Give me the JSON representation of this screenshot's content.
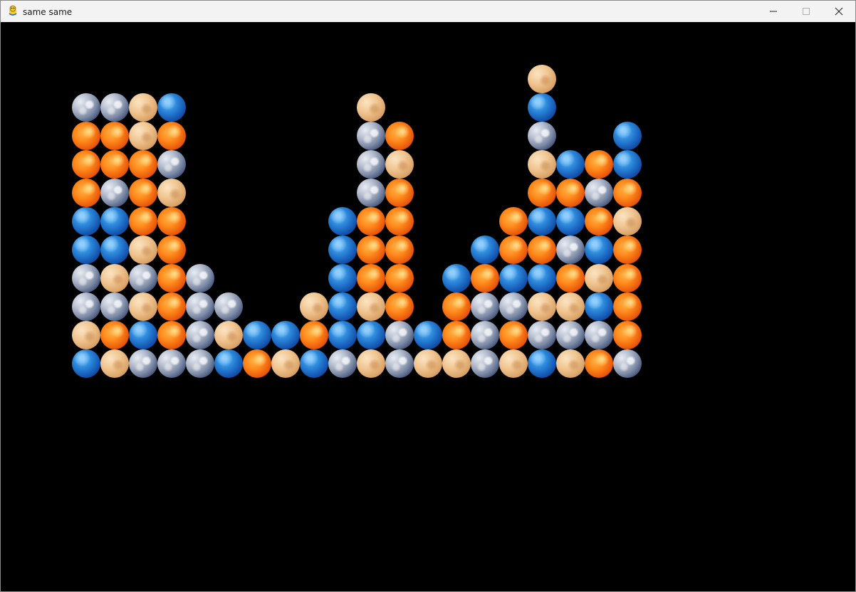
{
  "window": {
    "title": "same same",
    "minimize_icon": "minimize-icon",
    "maximize_icon": "maximize-icon",
    "close_icon": "close-icon",
    "app_icon": "pygame-snake-icon"
  },
  "game": {
    "background": "#000000",
    "colors": {
      "E": "earth",
      "B": "blue",
      "S": "sun",
      "T": "sand"
    },
    "columns": [
      [
        "B",
        "T",
        "E",
        "E",
        "B",
        "B",
        "S",
        "S",
        "S",
        "E"
      ],
      [
        "T",
        "S",
        "E",
        "T",
        "B",
        "B",
        "E",
        "S",
        "S",
        "E"
      ],
      [
        "E",
        "B",
        "T",
        "E",
        "T",
        "S",
        "S",
        "S",
        "T",
        "T"
      ],
      [
        "E",
        "S",
        "S",
        "S",
        "S",
        "S",
        "T",
        "E",
        "S",
        "B"
      ],
      [
        "E",
        "E",
        "E",
        "E"
      ],
      [
        "B",
        "T",
        "E"
      ],
      [
        "S",
        "B"
      ],
      [
        "T",
        "B"
      ],
      [
        "B",
        "S",
        "T"
      ],
      [
        "E",
        "B",
        "B",
        "B",
        "B",
        "B"
      ],
      [
        "T",
        "B",
        "T",
        "S",
        "S",
        "S",
        "E",
        "E",
        "E",
        "T"
      ],
      [
        "E",
        "E",
        "S",
        "S",
        "S",
        "S",
        "S",
        "T",
        "S"
      ],
      [
        "T",
        "B"
      ],
      [
        "T",
        "S",
        "S",
        "B"
      ],
      [
        "E",
        "E",
        "E",
        "S",
        "B"
      ],
      [
        "T",
        "S",
        "E",
        "B",
        "S",
        "S"
      ],
      [
        "B",
        "E",
        "T",
        "B",
        "S",
        "B",
        "S",
        "T",
        "E",
        "B",
        "T"
      ],
      [
        "T",
        "E",
        "T",
        "S",
        "E",
        "B",
        "S",
        "B"
      ],
      [
        "S",
        "E",
        "B",
        "T",
        "B",
        "S",
        "E",
        "S"
      ],
      [
        "E",
        "S",
        "S",
        "S",
        "S",
        "T",
        "S",
        "B",
        "B"
      ]
    ]
  }
}
